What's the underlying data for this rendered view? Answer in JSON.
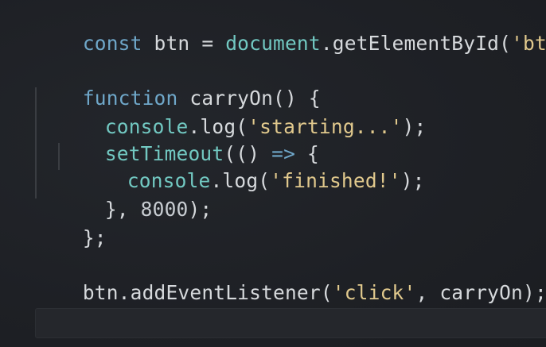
{
  "editor": {
    "lines": [
      {
        "tokens": [
          {
            "text": "const",
            "kind": "keyword"
          },
          {
            "text": " btn = ",
            "kind": "plain"
          },
          {
            "text": "document",
            "kind": "builtin"
          },
          {
            "text": ".getElementById(",
            "kind": "func"
          },
          {
            "text": "'btn'",
            "kind": "string"
          },
          {
            "text": ");",
            "kind": "plain"
          }
        ]
      },
      {
        "tokens": [
          {
            "text": "function",
            "kind": "keyword"
          },
          {
            "text": " carryOn() {",
            "kind": "plain"
          }
        ]
      },
      {
        "tokens": [
          {
            "text": "console",
            "kind": "builtin"
          },
          {
            "text": ".log(",
            "kind": "func"
          },
          {
            "text": "'starting...'",
            "kind": "string"
          },
          {
            "text": ");",
            "kind": "plain"
          }
        ]
      },
      {
        "tokens": [
          {
            "text": "setTimeout",
            "kind": "builtin"
          },
          {
            "text": "(() ",
            "kind": "plain"
          },
          {
            "text": "=>",
            "kind": "arrow"
          },
          {
            "text": " {",
            "kind": "plain"
          }
        ]
      },
      {
        "tokens": [
          {
            "text": "console",
            "kind": "builtin"
          },
          {
            "text": ".log(",
            "kind": "func"
          },
          {
            "text": "'finished!'",
            "kind": "string"
          },
          {
            "text": ");",
            "kind": "plain"
          }
        ]
      },
      {
        "tokens": [
          {
            "text": "}, ",
            "kind": "plain"
          },
          {
            "text": "8000",
            "kind": "number"
          },
          {
            "text": ");",
            "kind": "plain"
          }
        ]
      },
      {
        "tokens": [
          {
            "text": "};",
            "kind": "plain"
          }
        ]
      },
      {
        "tokens": [
          {
            "text": "btn.addEventListener(",
            "kind": "plain"
          },
          {
            "text": "'click'",
            "kind": "string"
          },
          {
            "text": ", carryOn);",
            "kind": "plain"
          }
        ]
      }
    ]
  },
  "colors": {
    "background": "#1f2126",
    "keyword": "#6fa7c9",
    "builtin": "#72c9c2",
    "string": "#e1c98d",
    "plain": "#d6d9dc"
  }
}
